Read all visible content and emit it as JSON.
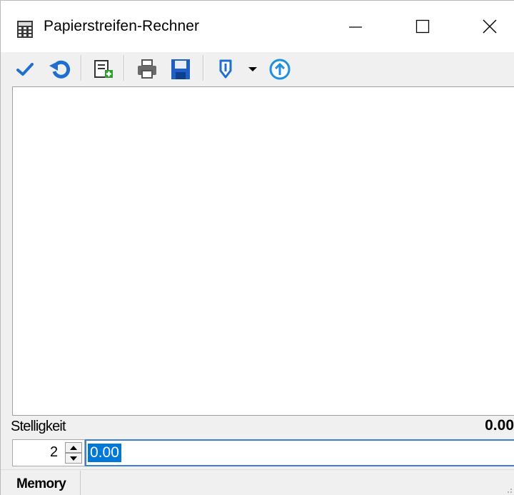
{
  "window": {
    "title": "Papierstreifen-Rechner",
    "icon": "calculator-icon"
  },
  "titlebar_buttons": {
    "minimize": "minimize-icon",
    "maximize": "maximize-icon",
    "close": "close-icon"
  },
  "toolbar": {
    "items": [
      {
        "icon": "checkmark-icon",
        "color": "#1f6fd0"
      },
      {
        "icon": "undo-icon",
        "color": "#1f6fd0"
      },
      {
        "icon": "new-entry-icon",
        "color": "#2e9e2e"
      },
      {
        "icon": "print-icon",
        "color": "#555555"
      },
      {
        "icon": "save-icon",
        "color": "#1f5fc4"
      },
      {
        "icon": "clip-dropdown-icon",
        "color": "#1f6fd0"
      },
      {
        "icon": "upload-circle-icon",
        "color": "#1f8fe0"
      }
    ]
  },
  "tape": {
    "entries": []
  },
  "precision": {
    "label": "Stelligkeit",
    "value": "2",
    "total": "0.00"
  },
  "entry": {
    "value": "0.00"
  },
  "statusbar": {
    "memory_label": "Memory"
  },
  "colors": {
    "selection": "#0078d7",
    "focus_border": "#3c7fd1",
    "background": "#f0f0f0"
  }
}
